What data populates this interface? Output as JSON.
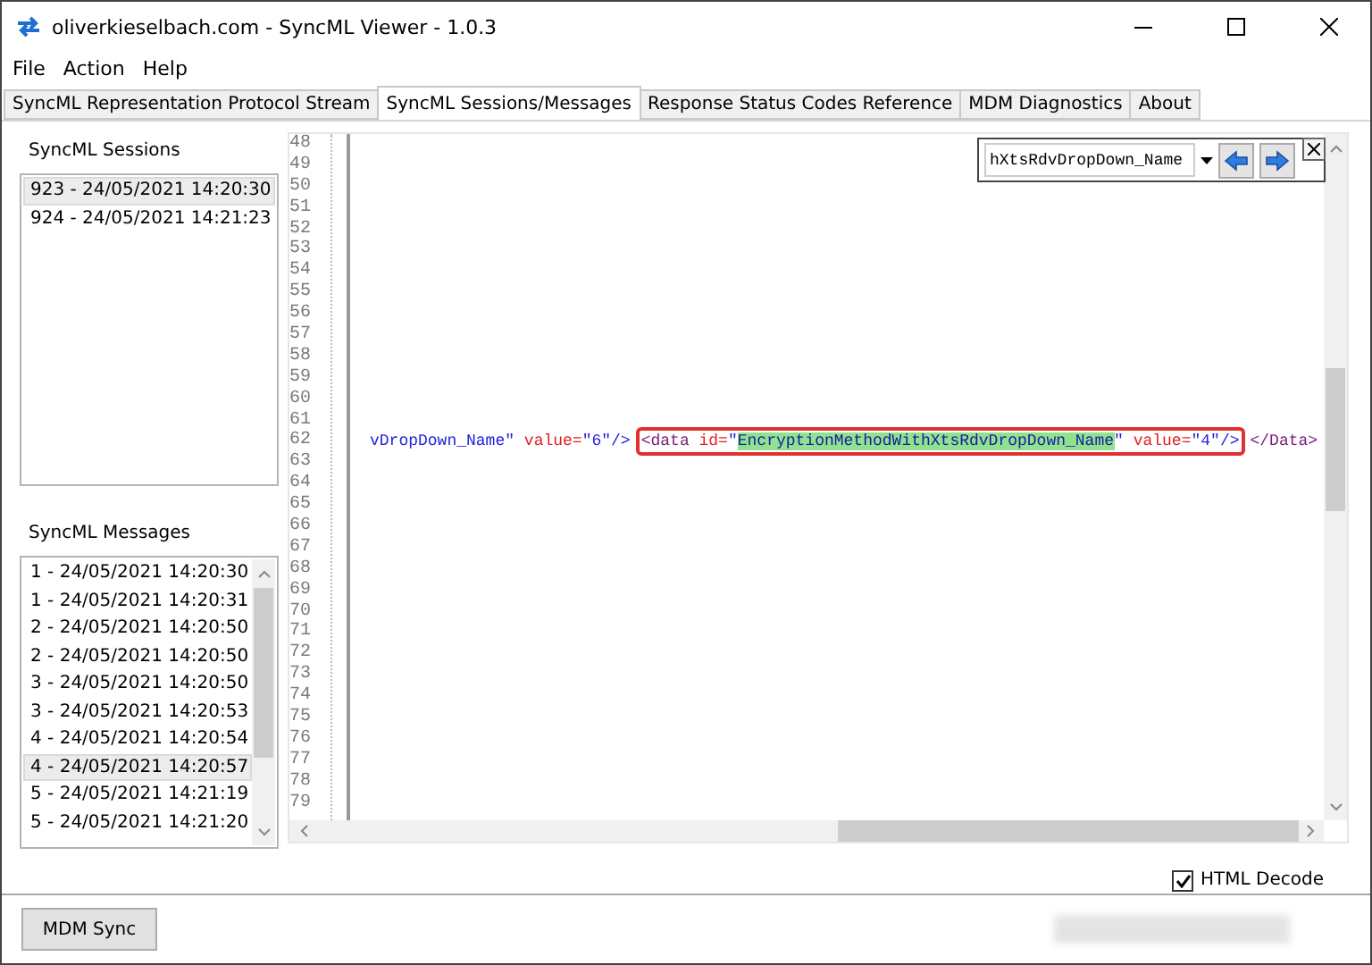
{
  "window": {
    "title": "oliverkieselbach.com - SyncML Viewer - 1.0.3"
  },
  "menu": [
    "File",
    "Action",
    "Help"
  ],
  "tabs": [
    {
      "label": "SyncML Representation Protocol Stream",
      "selected": false
    },
    {
      "label": "SyncML Sessions/Messages",
      "selected": true
    },
    {
      "label": "Response Status Codes Reference",
      "selected": false
    },
    {
      "label": "MDM Diagnostics",
      "selected": false
    },
    {
      "label": "About",
      "selected": false
    }
  ],
  "sessions": {
    "label": "SyncML Sessions",
    "items": [
      {
        "text": "923 - 24/05/2021 14:20:30",
        "selected": true
      },
      {
        "text": "924 - 24/05/2021 14:21:23",
        "selected": false
      }
    ]
  },
  "messages": {
    "label": "SyncML Messages",
    "items": [
      {
        "text": "1 - 24/05/2021 14:20:30",
        "selected": false
      },
      {
        "text": "1 - 24/05/2021 14:20:31",
        "selected": false
      },
      {
        "text": "2 - 24/05/2021 14:20:50",
        "selected": false
      },
      {
        "text": "2 - 24/05/2021 14:20:50",
        "selected": false
      },
      {
        "text": "3 - 24/05/2021 14:20:50",
        "selected": false
      },
      {
        "text": "3 - 24/05/2021 14:20:53",
        "selected": false
      },
      {
        "text": "4 - 24/05/2021 14:20:54",
        "selected": false
      },
      {
        "text": "4 - 24/05/2021 14:20:57",
        "selected": true
      },
      {
        "text": "5 - 24/05/2021 14:21:19",
        "selected": false
      },
      {
        "text": "5 - 24/05/2021 14:21:20",
        "selected": false
      }
    ]
  },
  "editor": {
    "lines": [
      {
        "number": "48"
      },
      {
        "number": "49"
      },
      {
        "number": "50"
      },
      {
        "number": "51"
      },
      {
        "number": "52"
      },
      {
        "number": "53"
      },
      {
        "number": "54"
      },
      {
        "number": "55"
      },
      {
        "number": "56"
      },
      {
        "number": "57"
      },
      {
        "number": "58"
      },
      {
        "number": "59"
      },
      {
        "number": "60"
      },
      {
        "number": "61"
      },
      {
        "number": "62",
        "segments": [
          {
            "outlined": false,
            "tokens": [
              {
                "text": "vDropDown_Name\"",
                "kind": "value"
              },
              {
                "text": " value=",
                "kind": "attr"
              },
              {
                "text": "\"6\"",
                "kind": "value"
              },
              {
                "text": "/>",
                "kind": "tag"
              }
            ]
          },
          {
            "outlined": true,
            "tokens": [
              {
                "text": "<data",
                "kind": "element"
              },
              {
                "text": " id=",
                "kind": "attr"
              },
              {
                "text": "\"",
                "kind": "value"
              },
              {
                "text": "EncryptionMethodWithXtsRdvDropDown_Name",
                "kind": "match"
              },
              {
                "text": "\"",
                "kind": "value"
              },
              {
                "text": " value=",
                "kind": "attr"
              },
              {
                "text": "\"4\"",
                "kind": "value"
              },
              {
                "text": "/>",
                "kind": "tag"
              }
            ]
          },
          {
            "outlined": false,
            "tokens": [
              {
                "text": "</Data>",
                "kind": "element"
              }
            ]
          }
        ]
      },
      {
        "number": "63"
      },
      {
        "number": "64"
      },
      {
        "number": "65"
      },
      {
        "number": "66"
      },
      {
        "number": "67"
      },
      {
        "number": "68"
      },
      {
        "number": "69"
      },
      {
        "number": "70"
      },
      {
        "number": "71"
      },
      {
        "number": "72"
      },
      {
        "number": "73"
      },
      {
        "number": "74"
      },
      {
        "number": "75"
      },
      {
        "number": "76"
      },
      {
        "number": "77"
      },
      {
        "number": "78"
      },
      {
        "number": "79"
      }
    ],
    "find": {
      "value": "hXtsRdvDropDown_Name"
    }
  },
  "html_decode": {
    "label": "HTML Decode",
    "checked": true
  },
  "buttons": [
    "MDM Sync"
  ]
}
